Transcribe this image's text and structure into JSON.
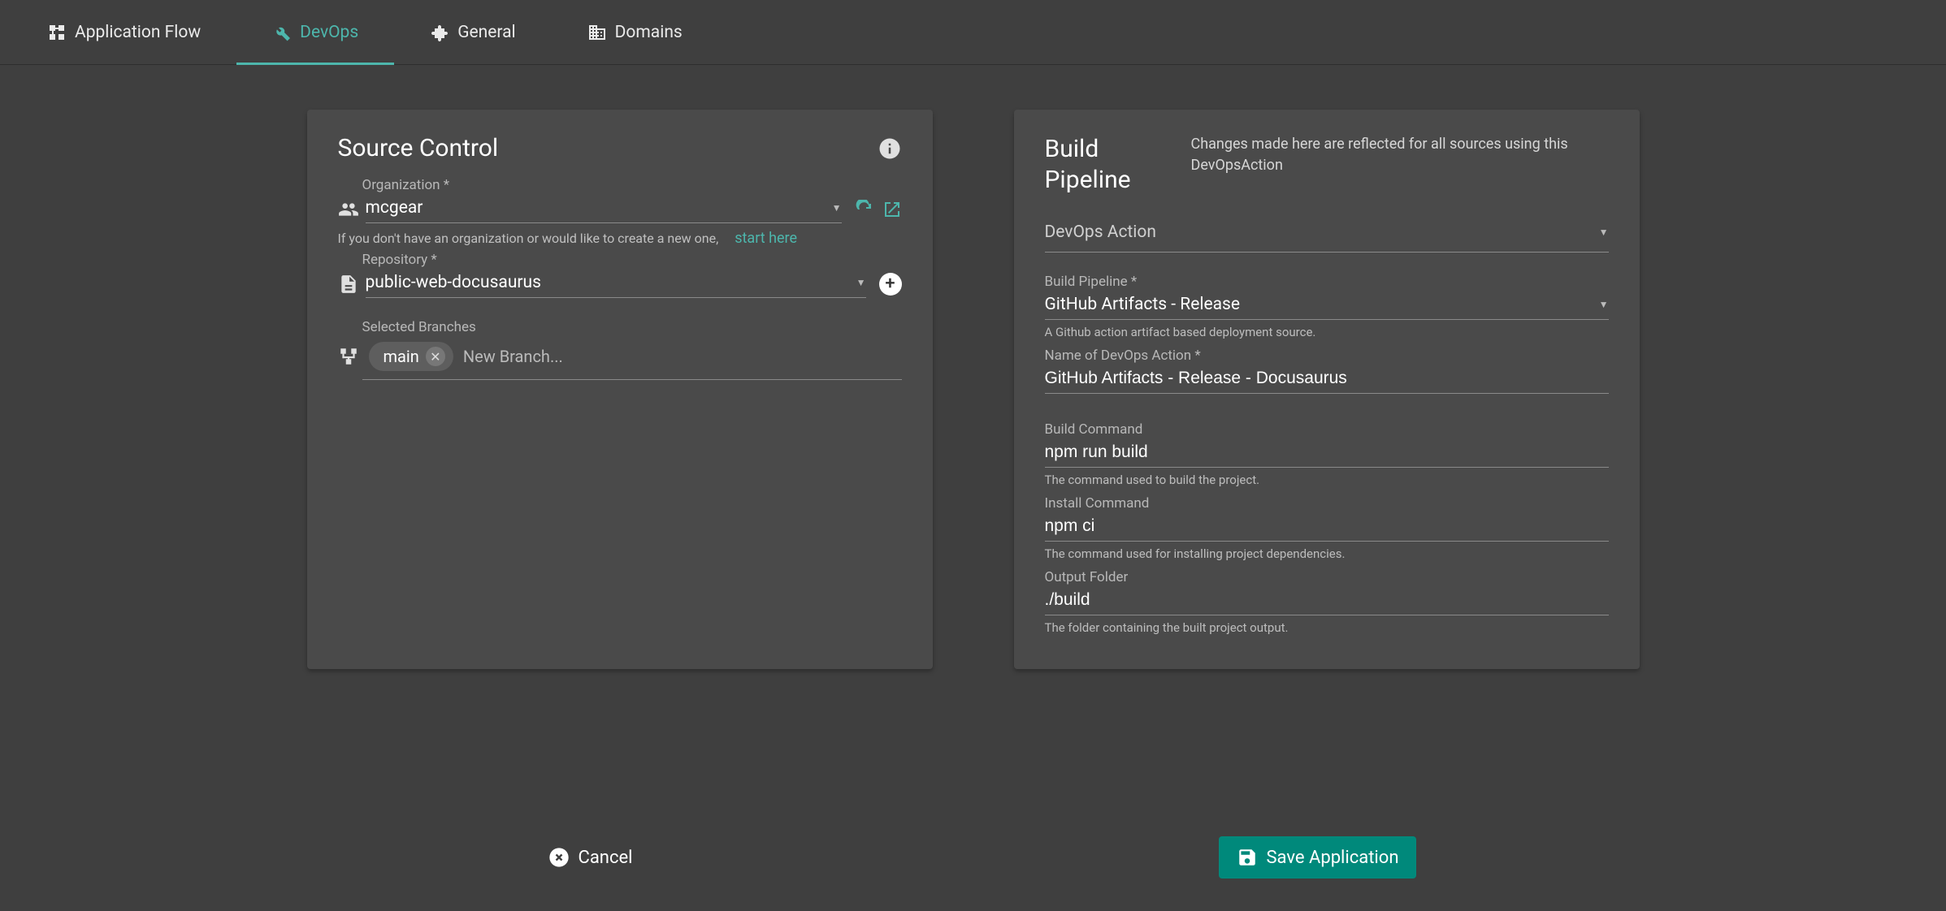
{
  "tabs": {
    "app_flow": "Application Flow",
    "devops": "DevOps",
    "general": "General",
    "domains": "Domains"
  },
  "source_control": {
    "title": "Source Control",
    "organization_label": "Organization *",
    "organization_value": "mcgear",
    "org_help_text": "If you don't have an organization or would like to create a new one,",
    "start_here": "start here",
    "repository_label": "Repository *",
    "repository_value": "public-web-docusaurus",
    "branches_label": "Selected Branches",
    "branch_chip": "main",
    "branch_placeholder": "New Branch..."
  },
  "build_pipeline": {
    "title": "Build Pipeline",
    "subtitle": "Changes made here are reflected for all sources using this DevOpsAction",
    "devops_action_placeholder": "DevOps Action",
    "build_pipeline_label": "Build Pipeline *",
    "build_pipeline_value": "GitHub Artifacts - Release",
    "build_pipeline_hint": "A Github action artifact based deployment source.",
    "action_name_label": "Name of DevOps Action *",
    "action_name_value": "GitHub Artifacts - Release - Docusaurus",
    "build_cmd_label": "Build Command",
    "build_cmd_value": "npm run build",
    "build_cmd_hint": "The command used to build the project.",
    "install_cmd_label": "Install Command",
    "install_cmd_value": "npm ci",
    "install_cmd_hint": "The command used for installing project dependencies.",
    "output_folder_label": "Output Folder",
    "output_folder_value": "./build",
    "output_folder_hint": "The folder containing the built project output."
  },
  "footer": {
    "cancel": "Cancel",
    "save": "Save Application"
  }
}
